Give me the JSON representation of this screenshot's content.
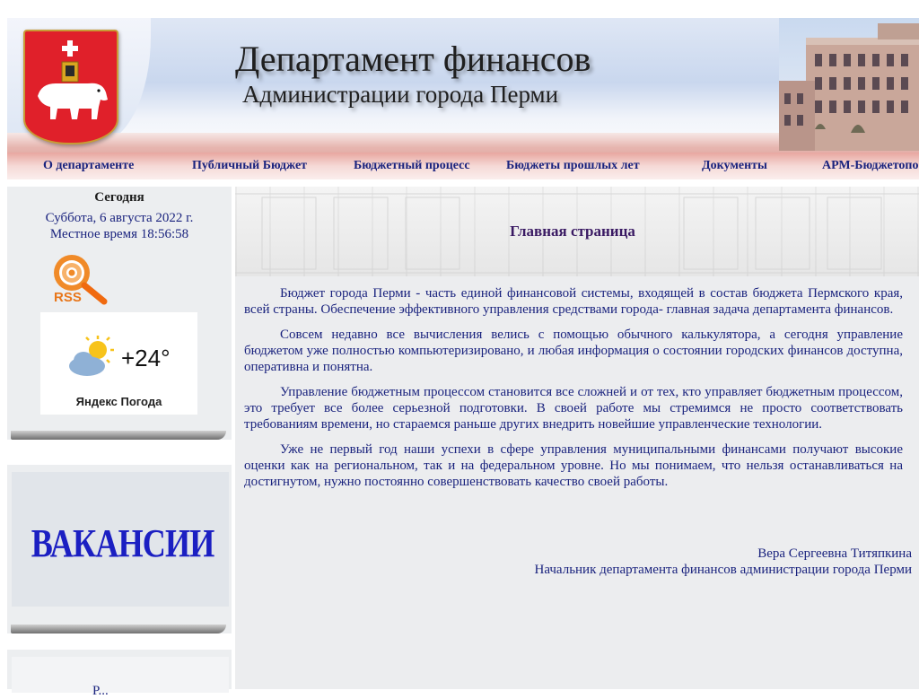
{
  "header": {
    "title": "Департамент финансов",
    "subtitle": "Администрации города Перми"
  },
  "nav": {
    "items": [
      {
        "label": "О департаменте"
      },
      {
        "label": "Публичный Бюджет"
      },
      {
        "label": "Бюджетный процесс"
      },
      {
        "label": "Бюджеты прошлых лет"
      },
      {
        "label": "Документы"
      },
      {
        "label": "АРМ-Бюджетопо"
      }
    ]
  },
  "sidebar": {
    "today_heading": "Сегодня",
    "date": "Суббота, 6 августа 2022 г.",
    "local_time": "Местное время 18:56:58",
    "rss_label": "RSS",
    "weather": {
      "temperature": "+24°",
      "brand": "Яндекс Погода"
    },
    "vacancies_label": "ВАКАНСИИ",
    "next_box_partial": "Р..."
  },
  "main": {
    "page_title": "Главная страница",
    "paragraphs": [
      "Бюджет города Перми - часть единой финансовой системы, входящей в состав бюджета Пермского края, всей страны. Обеспечение эффективного управления средствами города- главная задача департамента финансов.",
      "Совсем недавно все вычисления велись с помощью обычного калькулятора, а сегодня управление бюджетом уже полностью компьютеризировано, и любая информация о состоянии городских финансов доступна, оперативна и понятна.",
      "Управление бюджетным процессом становится все сложней и от тех, кто управляет бюджетным процессом, это требует все более серьезной подготовки. В своей работе мы стремимся не просто соответствовать требованиям времени, но стараемся раньше других внедрить новейшие управленческие технологии.",
      "Уже не первый год наши успехи в сфере управления муниципальными финансами получают высокие оценки как на региональном, так и на федеральном уровне. Но мы понимаем, что нельзя останавливаться на достигнутом, нужно постоянно совершенствовать качество своей работы."
    ],
    "signature_name": "Вера Сергеевна Титяпкина",
    "signature_position": "Начальник департамента финансов администрации города Перми"
  },
  "colors": {
    "nav_text": "#1a237e",
    "body_text": "#1a237e",
    "title_text": "#3a1a63",
    "vacancies_text": "#1b1fc2",
    "coat_red": "#e0202a"
  },
  "icons": [
    "coat-of-arms-icon",
    "rss-icon",
    "weather-cloud-sun-icon"
  ]
}
